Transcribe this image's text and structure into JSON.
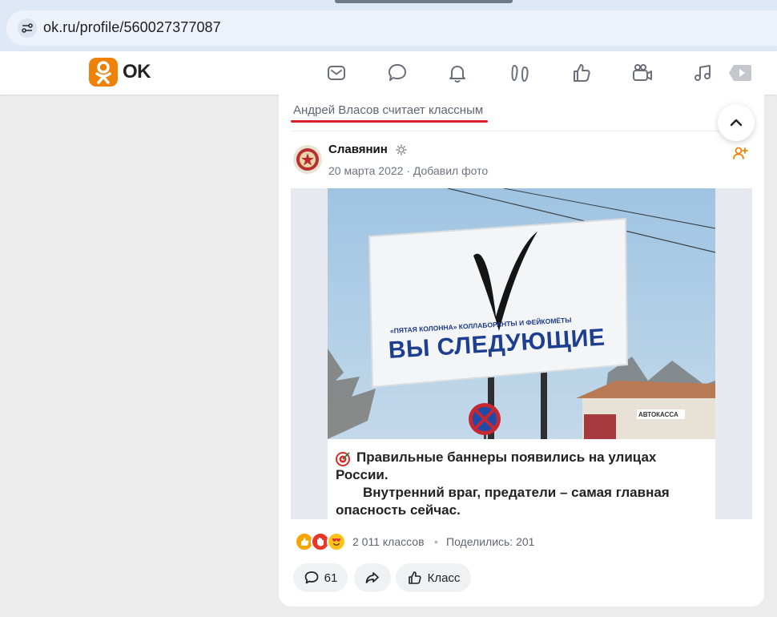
{
  "browser": {
    "url": "ok.ru/profile/560027377087"
  },
  "header": {
    "logo_text": "OK"
  },
  "nav_icons": [
    "mail-icon",
    "discussions-icon",
    "notifications-icon",
    "guests-icon",
    "events-icon",
    "video-icon",
    "music-icon",
    "games-icon"
  ],
  "post": {
    "liked_by": "Андрей Власов считает классным",
    "author": "Славянин",
    "meta": "20 марта 2022 · Добавил фото",
    "caption": {
      "line1": "Правильные баннеры появились на улицах",
      "line2": "России.",
      "line3": "Внутренний враг, предатели – самая главная",
      "line4": "опасность сейчас."
    },
    "billboard": {
      "subtitle": "«ПЯТАЯ КОЛОННА» КОЛЛАБОРАНТЫ И ФЕЙКОМЁТЫ",
      "headline": "ВЫ СЛЕДУЮЩИЕ"
    },
    "shop_sign": "АВТОКАССА",
    "likes": "2 011 классов",
    "separator": "•",
    "shares": "Поделились: 201",
    "comments": "61",
    "class_button": "Класс"
  },
  "colors": {
    "accent": "#ee8208",
    "liked_underline": "#d8202b"
  }
}
